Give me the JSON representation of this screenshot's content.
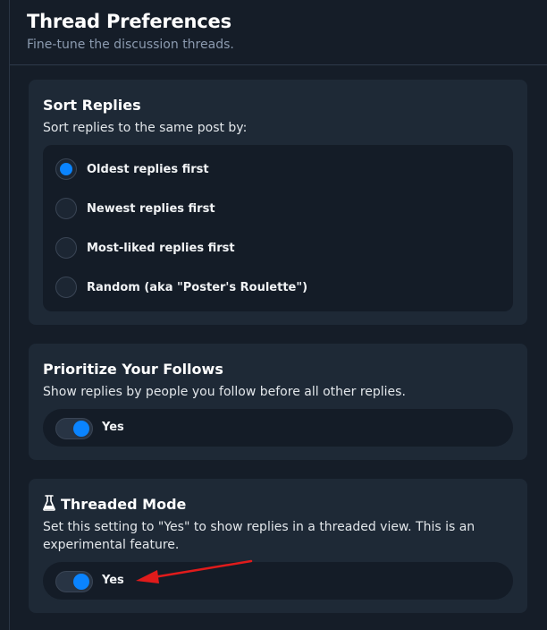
{
  "header": {
    "title": "Thread Preferences",
    "subtitle": "Fine-tune the discussion threads."
  },
  "sort_replies": {
    "title": "Sort Replies",
    "description": "Sort replies to the same post by:",
    "options": [
      {
        "label": "Oldest replies first",
        "checked": true
      },
      {
        "label": "Newest replies first",
        "checked": false
      },
      {
        "label": "Most-liked replies first",
        "checked": false
      },
      {
        "label": "Random (aka \"Poster's Roulette\")",
        "checked": false
      }
    ]
  },
  "prioritize_follows": {
    "title": "Prioritize Your Follows",
    "description": "Show replies by people you follow before all other replies.",
    "toggle_label": "Yes",
    "enabled": true
  },
  "threaded_mode": {
    "icon": "flask-icon",
    "title": "Threaded Mode",
    "description": "Set this setting to \"Yes\" to show replies in a threaded view. This is an experimental feature.",
    "toggle_label": "Yes",
    "enabled": true
  },
  "colors": {
    "accent": "#0a84ff",
    "background": "#151d28",
    "card": "#1e2936",
    "annotation_arrow": "#e01b1b"
  }
}
